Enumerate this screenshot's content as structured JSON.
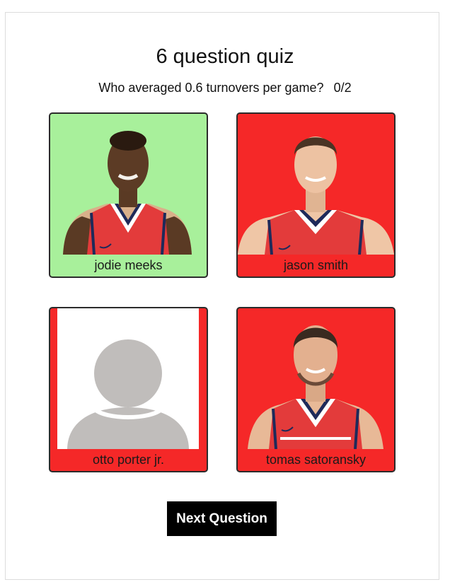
{
  "quiz": {
    "title": "6 question quiz",
    "question": "Who averaged 0.6 turnovers per game?",
    "score": "0/2"
  },
  "options": [
    {
      "name": "jodie meeks",
      "state": "correct",
      "color": "#a8f09b",
      "photo": "player-photo"
    },
    {
      "name": "jason smith",
      "state": "wrong",
      "color": "#f52828",
      "photo": "player-photo"
    },
    {
      "name": "otto porter jr.",
      "state": "wrong",
      "color": "#f52828",
      "photo": "avatar-placeholder-icon"
    },
    {
      "name": "tomas satoransky",
      "state": "wrong",
      "color": "#f52828",
      "photo": "player-photo"
    }
  ],
  "actions": {
    "next_label": "Next Question"
  }
}
